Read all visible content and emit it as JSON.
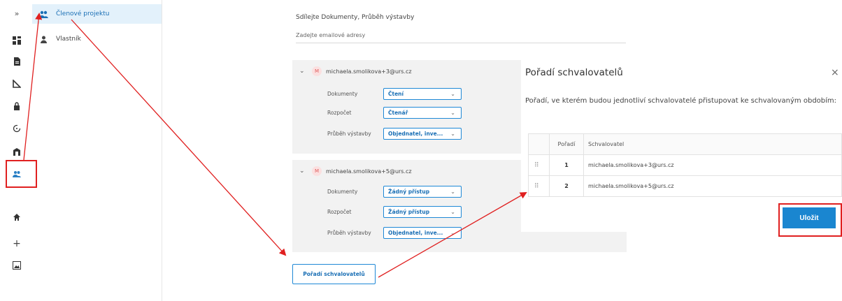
{
  "rail": {
    "expand_glyph": "»",
    "icons": [
      "expand-icon",
      "dashboard-icon",
      "document-icon",
      "ruler-icon",
      "lock-icon",
      "refresh-icon",
      "building-icon",
      "users-icon",
      "home-icon",
      "plus-icon",
      "image-icon"
    ]
  },
  "sidebar": {
    "items": [
      {
        "label": "Členové projektu",
        "icon": "users-icon",
        "active": true
      },
      {
        "label": "Vlastník",
        "icon": "person-icon",
        "active": false
      }
    ]
  },
  "share": {
    "title": "Sdílejte Dokumenty, Průběh výstavby",
    "email_placeholder": "Zadejte emailové adresy"
  },
  "members": [
    {
      "avatar": "M",
      "email": "michaela.smolikova+3@urs.cz",
      "permissions": [
        {
          "label": "Dokumenty",
          "value": "Čtení"
        },
        {
          "label": "Rozpočet",
          "value": "Čtenář"
        },
        {
          "label": "Průběh výstavby",
          "value": "Objednatel, inve..."
        }
      ]
    },
    {
      "avatar": "M",
      "email": "michaela.smolikova+5@urs.cz",
      "permissions": [
        {
          "label": "Dokumenty",
          "value": "Žádný přístup"
        },
        {
          "label": "Rozpočet",
          "value": "Žádný přístup"
        },
        {
          "label": "Průběh výstavby",
          "value": "Objednatel, inve..."
        }
      ]
    }
  ],
  "order_button": {
    "label": "Pořadí schvalovatelů"
  },
  "dialog": {
    "title": "Pořadí schvalovatelů",
    "close_glyph": "×",
    "description": "Pořadí, ve kterém budou jednotliví schvalovatelé přistupovat ke schvalovaným obdobím:",
    "columns": [
      "",
      "Pořadí",
      "Schvalovatel"
    ],
    "rows": [
      {
        "handle": "⠿",
        "order": "1",
        "approver": "michaela.smolikova+3@urs.cz"
      },
      {
        "handle": "⠿",
        "order": "2",
        "approver": "michaela.smolikova+5@urs.cz"
      }
    ],
    "save_label": "Uložit"
  },
  "colors": {
    "accent": "#1a86d0",
    "annotation": "#e02020",
    "active_bg": "#e3f1fb"
  }
}
